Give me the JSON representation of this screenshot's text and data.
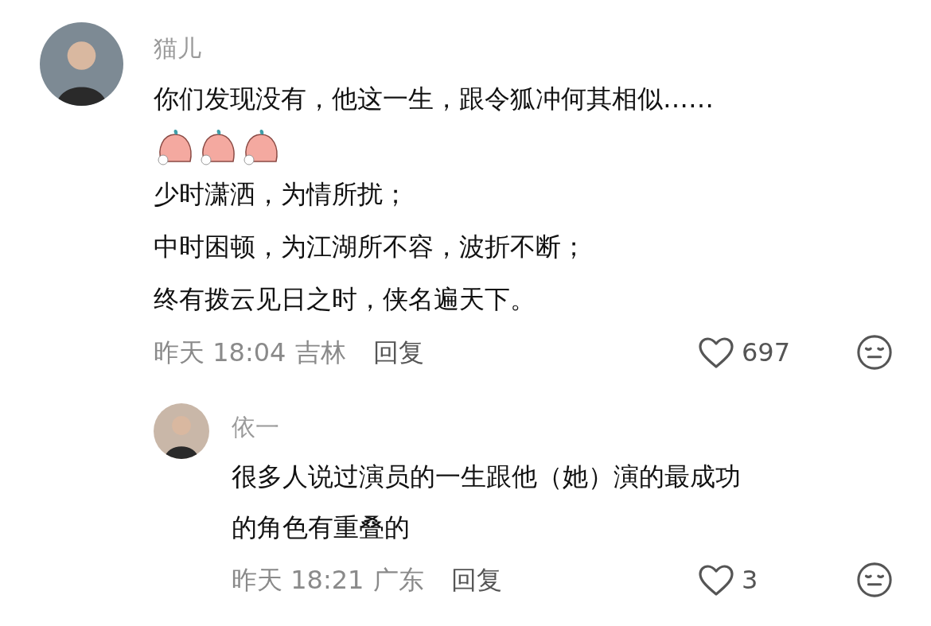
{
  "comments": [
    {
      "author": "猫儿",
      "lines": [
        "你们发现没有，他这一生，跟令狐冲何其相似……",
        "少时潇洒，为情所扰；",
        "中时困顿，为江湖所不容，波折不断；",
        "终有拨云见日之时，侠名遍天下。"
      ],
      "stickers": [
        {
          "kind": "sticker"
        },
        {
          "kind": "sticker"
        },
        {
          "kind": "sticker"
        }
      ],
      "time": "昨天 18:04",
      "location": "吉林",
      "reply": "回复",
      "likes": "697",
      "liked": false,
      "replies": [
        {
          "author": "依一",
          "lines": [
            "很多人说过演员的一生跟他（她）演的最成功",
            "的角色有重叠的"
          ],
          "time": "昨天 18:21",
          "location": "广东",
          "reply": "回复",
          "likes": "3",
          "liked": false
        }
      ]
    }
  ]
}
